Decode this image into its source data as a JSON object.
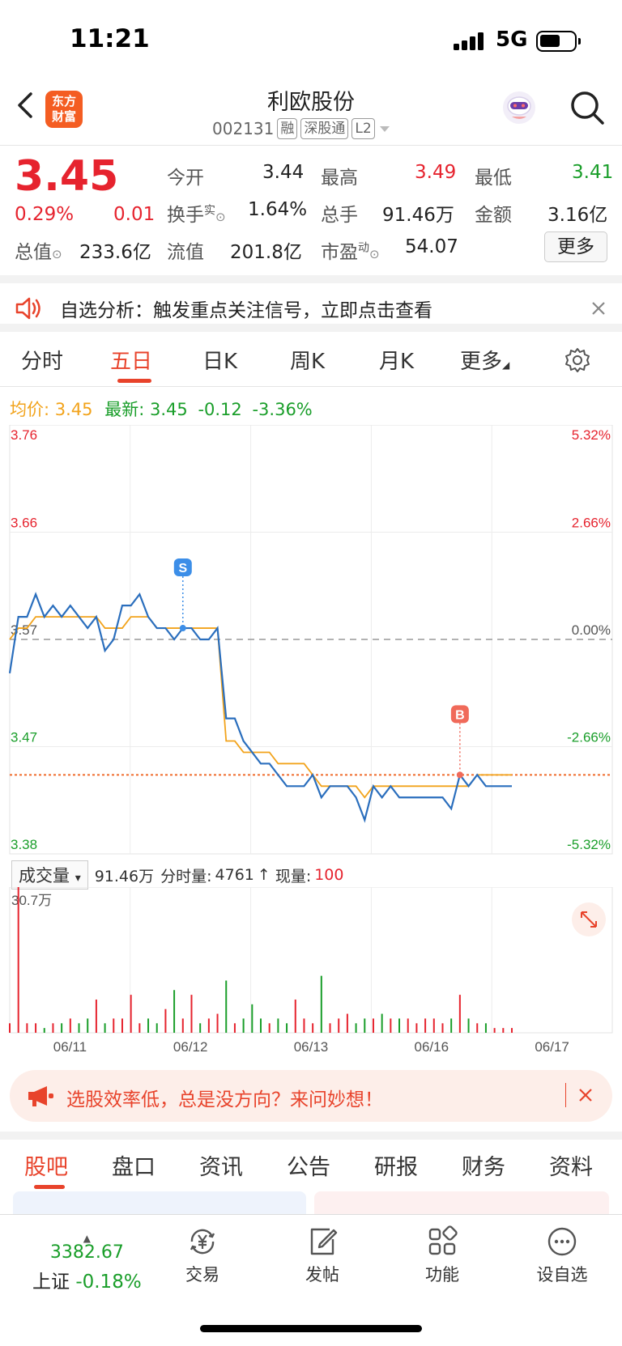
{
  "status": {
    "time": "11:21",
    "network": "5G",
    "battery_level": 0.6
  },
  "header": {
    "stock_name": "利欧股份",
    "code": "002131",
    "tags": [
      "融",
      "深股通",
      "L2"
    ],
    "logo_line1": "东方",
    "logo_line2": "财富"
  },
  "quote": {
    "price": "3.45",
    "change_pct": "0.29%",
    "change": "0.01",
    "open_label": "今开",
    "open": "3.44",
    "high_label": "最高",
    "high": "3.49",
    "low_label": "最低",
    "low": "3.41",
    "turnover_label": "换手",
    "turnover_sup": "实",
    "turnover": "1.64%",
    "volume_label": "总手",
    "volume": "91.46万",
    "amount_label": "金额",
    "amount": "3.16亿",
    "mktcap_label": "总值",
    "mktcap": "233.6亿",
    "float_label": "流值",
    "float": "201.8亿",
    "pe_label": "市盈",
    "pe_sup": "动",
    "pe": "54.07",
    "more_label": "更多"
  },
  "notice": {
    "text": "自选分析：触发重点关注信号，立即点击查看"
  },
  "tabs": [
    "分时",
    "五日",
    "日K",
    "周K",
    "月K",
    "更多"
  ],
  "active_tab": 1,
  "infoline": {
    "avg_label": "均价:",
    "avg": "3.45",
    "latest_label": "最新:",
    "latest": "3.45",
    "chg": "-0.12",
    "chg_pct": "-3.36%"
  },
  "chart_data": {
    "type": "line",
    "x_labels": [
      "06/11",
      "06/12",
      "06/13",
      "06/16",
      "06/17"
    ],
    "y_left": [
      "3.76",
      "3.66",
      "3.57",
      "3.47",
      "3.38"
    ],
    "y_right": [
      "5.32%",
      "2.66%",
      "0.00%",
      "-2.66%",
      "-5.32%"
    ],
    "ylim": [
      3.38,
      3.76
    ],
    "prev_close": 3.57,
    "current": 3.45,
    "series": [
      {
        "name": "最新",
        "color": "#2a6ebd",
        "values": [
          3.54,
          3.59,
          3.59,
          3.61,
          3.59,
          3.6,
          3.59,
          3.6,
          3.59,
          3.58,
          3.59,
          3.56,
          3.57,
          3.6,
          3.6,
          3.61,
          3.59,
          3.58,
          3.58,
          3.57,
          3.58,
          3.58,
          3.57,
          3.57,
          3.58,
          3.5,
          3.5,
          3.48,
          3.47,
          3.46,
          3.46,
          3.45,
          3.44,
          3.44,
          3.44,
          3.45,
          3.43,
          3.44,
          3.44,
          3.44,
          3.43,
          3.41,
          3.44,
          3.43,
          3.44,
          3.43,
          3.43,
          3.43,
          3.43,
          3.43,
          3.43,
          3.42,
          3.45,
          3.44,
          3.45,
          3.44,
          3.44,
          3.44,
          3.44
        ]
      },
      {
        "name": "均价",
        "color": "#f2a31b",
        "values": [
          3.57,
          3.58,
          3.58,
          3.59,
          3.59,
          3.59,
          3.59,
          3.59,
          3.59,
          3.59,
          3.59,
          3.58,
          3.58,
          3.58,
          3.59,
          3.59,
          3.59,
          3.58,
          3.58,
          3.58,
          3.58,
          3.58,
          3.58,
          3.58,
          3.58,
          3.48,
          3.48,
          3.47,
          3.47,
          3.47,
          3.47,
          3.46,
          3.46,
          3.46,
          3.46,
          3.45,
          3.44,
          3.44,
          3.44,
          3.44,
          3.44,
          3.43,
          3.44,
          3.44,
          3.44,
          3.44,
          3.44,
          3.44,
          3.44,
          3.44,
          3.44,
          3.44,
          3.44,
          3.44,
          3.45,
          3.45,
          3.45,
          3.45,
          3.45
        ]
      }
    ],
    "markers": [
      {
        "label": "S",
        "index": 20,
        "value": 3.58
      },
      {
        "label": "B",
        "index": 52,
        "value": 3.45
      }
    ],
    "volume": {
      "label": "成交量",
      "total": "91.46万",
      "tick_label": "分时量:",
      "tick": "4761",
      "now_label": "现量:",
      "now": "100",
      "max_label": "30.7万",
      "ymax": 30.7,
      "values": [
        2,
        30.7,
        2,
        2,
        1,
        2,
        2,
        3,
        2,
        3,
        7,
        2,
        3,
        3,
        8,
        2,
        3,
        2,
        5,
        9,
        3,
        8,
        2,
        3,
        4,
        11,
        2,
        3,
        6,
        3,
        2,
        3,
        2,
        7,
        3,
        2,
        12,
        2,
        3,
        4,
        2,
        3,
        3,
        4,
        3,
        3,
        3,
        2,
        3,
        3,
        2,
        3,
        8,
        3,
        2,
        2,
        1,
        1,
        1
      ]
    }
  },
  "ad": {
    "text": "选股效率低，总是没方向？来问妙想！"
  },
  "bottom_tabs": [
    "股吧",
    "盘口",
    "资讯",
    "公告",
    "研报",
    "财务",
    "资料"
  ],
  "index": {
    "value": "3382.67",
    "name": "上证",
    "chg": "-0.18%"
  },
  "nav": [
    "交易",
    "发帖",
    "功能",
    "设自选"
  ]
}
